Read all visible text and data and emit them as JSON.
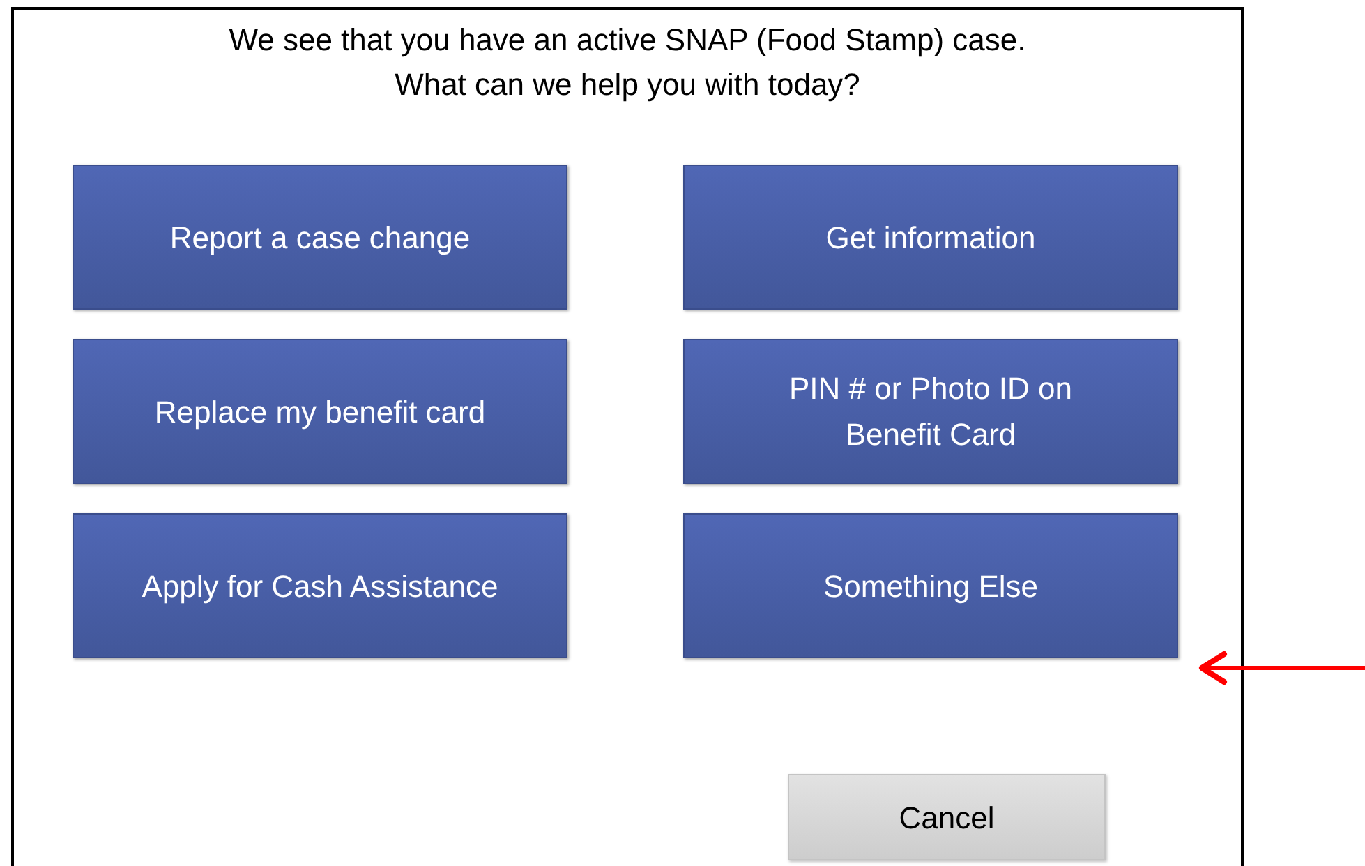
{
  "prompt": [
    "We see that you have an active SNAP (Food Stamp) case.",
    "What can we help you with today?"
  ],
  "option_rows": [
    [
      {
        "label": "Report a case change"
      },
      {
        "label": "Get information"
      }
    ],
    [
      {
        "label": "Replace my benefit card"
      },
      {
        "label": "PIN # or Photo ID on\nBenefit Card"
      }
    ],
    [
      {
        "label": "Apply for Cash Assistance"
      },
      {
        "label": "Something Else"
      }
    ]
  ],
  "cancel_button": "Cancel"
}
